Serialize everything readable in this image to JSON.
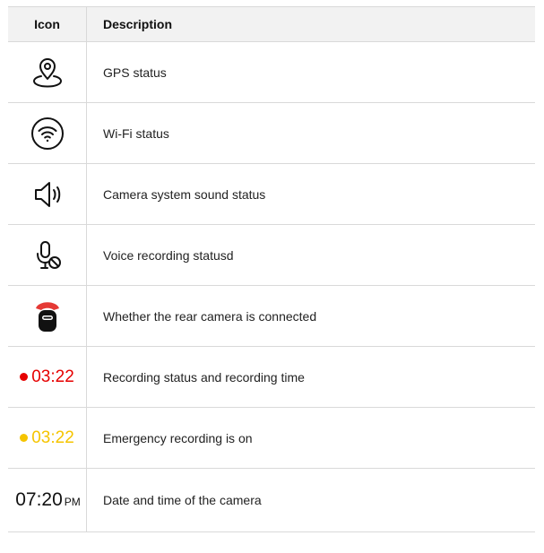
{
  "table": {
    "headers": {
      "icon": "Icon",
      "description": "Description"
    },
    "rows": [
      {
        "icon": "gps-location-pin-icon",
        "description": "GPS status"
      },
      {
        "icon": "wifi-icon",
        "description": "Wi-Fi status"
      },
      {
        "icon": "speaker-sound-icon",
        "description": "Camera system sound status"
      },
      {
        "icon": "microphone-off-icon",
        "description": "Voice recording statusd"
      },
      {
        "icon": "rear-camera-icon",
        "description": "Whether the rear camera is connected"
      },
      {
        "icon": "recording-dot-icon",
        "time": "03:22",
        "color": "#e60000",
        "description": "Recording status and recording time"
      },
      {
        "icon": "emergency-dot-icon",
        "time": "03:22",
        "color": "#f5c400",
        "description": "Emergency recording is on"
      },
      {
        "time": "07:20",
        "ampm": "PM",
        "description": "Date and time of the camera"
      }
    ]
  }
}
